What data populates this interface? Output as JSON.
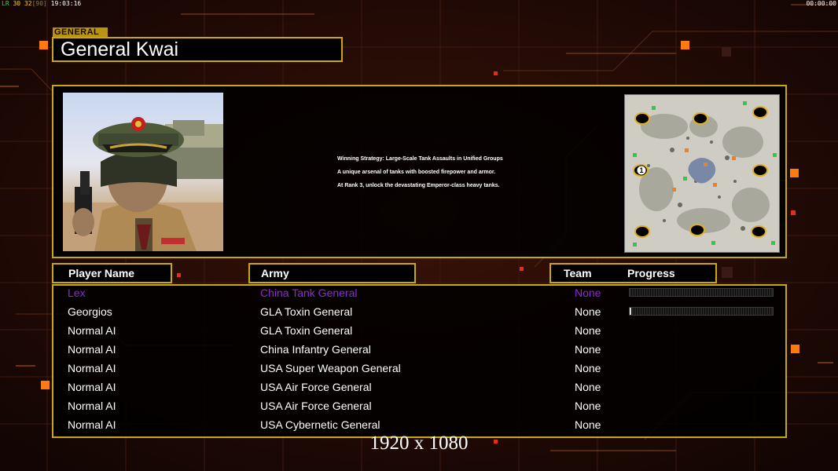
{
  "topbar": {
    "fps_label": "LR",
    "fps_value": "30",
    "frame_value": "32",
    "frame_cap": "[90]",
    "clock": "19:03:16",
    "timer": "00:00:00"
  },
  "general": {
    "tag": "GENERAL",
    "name": "General Kwai"
  },
  "strategy": {
    "lines": [
      "Winning Strategy: Large-Scale Tank Assaults in Unified Groups",
      "A unique arsenal of tanks with boosted firepower and armor.",
      "At Rank 3, unlock the devastating Emperor-class heavy tanks."
    ]
  },
  "minimap": {
    "start_marker": "1"
  },
  "headers": {
    "player_name": "Player Name",
    "army": "Army",
    "team": "Team",
    "progress": "Progress"
  },
  "players": [
    {
      "name": "Lex",
      "army": "China Tank General",
      "team": "None",
      "color": "#8a2bd8",
      "progress": 0.0
    },
    {
      "name": "Georgios",
      "army": "GLA Toxin General",
      "team": "None",
      "color": "#ffffff",
      "progress": 0.01
    },
    {
      "name": "Normal AI",
      "army": "GLA Toxin General",
      "team": "None",
      "color": "#ffffff"
    },
    {
      "name": "Normal AI",
      "army": "China Infantry General",
      "team": "None",
      "color": "#ffffff"
    },
    {
      "name": "Normal AI",
      "army": "USA Super Weapon General",
      "team": "None",
      "color": "#ffffff"
    },
    {
      "name": "Normal AI",
      "army": "USA Air Force General",
      "team": "None",
      "color": "#ffffff"
    },
    {
      "name": "Normal AI",
      "army": "USA Air Force General",
      "team": "None",
      "color": "#ffffff"
    },
    {
      "name": "Normal AI",
      "army": "USA Cybernetic General",
      "team": "None",
      "color": "#ffffff"
    }
  ],
  "resolution_note": "1920 x 1080",
  "colors": {
    "frame": "#c9a80c",
    "background": "#1a0705",
    "accent_orange": "#ff7a10"
  }
}
